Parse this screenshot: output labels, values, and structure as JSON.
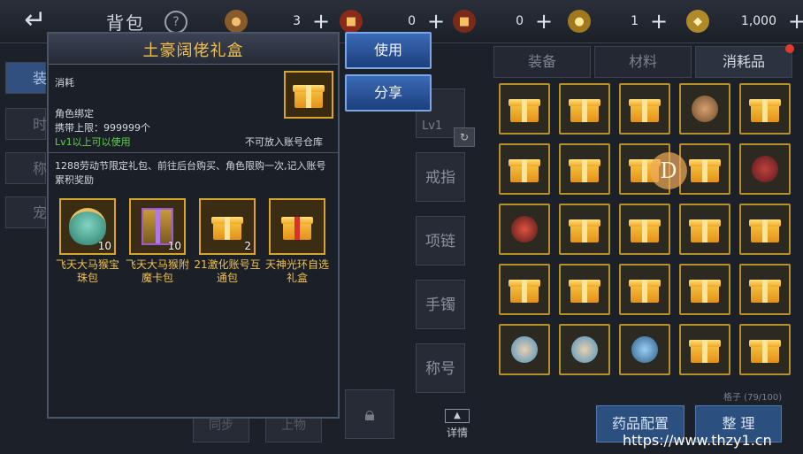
{
  "header": {
    "title": "背包",
    "help_icon": "?",
    "back_icon": "back-arrow-icon",
    "currencies": [
      {
        "icon": "copper-coin-icon",
        "value": "3"
      },
      {
        "icon": "red-scroll-icon",
        "value": "0"
      },
      {
        "icon": "red-scroll-icon",
        "value": "0"
      },
      {
        "icon": "gold-coin-icon",
        "value": "1"
      },
      {
        "icon": "gold-ingot-icon",
        "value": "1,000"
      }
    ]
  },
  "category_tabs": [
    "装备",
    "材料",
    "消耗品"
  ],
  "left_tabs": [
    "装",
    "时",
    "称",
    "宠"
  ],
  "equip_slots": {
    "level_label": "Lv1",
    "slots": [
      "戒指",
      "项链",
      "手镯",
      "称号"
    ]
  },
  "detail_label": "详情",
  "bottom_dim_buttons": [
    "同步",
    "上物"
  ],
  "inventory": {
    "capacity": "格子 (79/100)",
    "badge_letter": "D"
  },
  "bottom_buttons": {
    "potion_config": "药品配置",
    "sort": "整 理"
  },
  "popup": {
    "title": "土豪阔佬礼盒",
    "type": "消耗",
    "bind": "角色绑定",
    "carry_limit": "携带上限：999999个",
    "level_req": "Lv1以上可以使用",
    "warehouse_note": "不可放入账号仓库",
    "description": "1288劳动节限定礼包、前往后台购买、角色限购一次,记入账号累积奖励",
    "rewards": [
      {
        "name": "飞天大马猴宝珠包",
        "count": "10",
        "icon": "jade-pouch-icon"
      },
      {
        "name": "飞天大马猴附魔卡包",
        "count": "10",
        "icon": "purple-gift-box-icon"
      },
      {
        "name": "21激化账号互通包",
        "count": "2",
        "icon": "gold-gift-box-icon"
      },
      {
        "name": "天神光环自选礼盒",
        "count": "",
        "icon": "red-ribbon-gift-icon"
      }
    ]
  },
  "actions": {
    "use": "使用",
    "share": "分享"
  },
  "watermark": "https://www.thzy1.cn",
  "colors": {
    "gold_text": "#f2c14b",
    "green_text": "#62d04a",
    "button_blue": "#2d5aa8",
    "cell_border": "#b8902a"
  }
}
